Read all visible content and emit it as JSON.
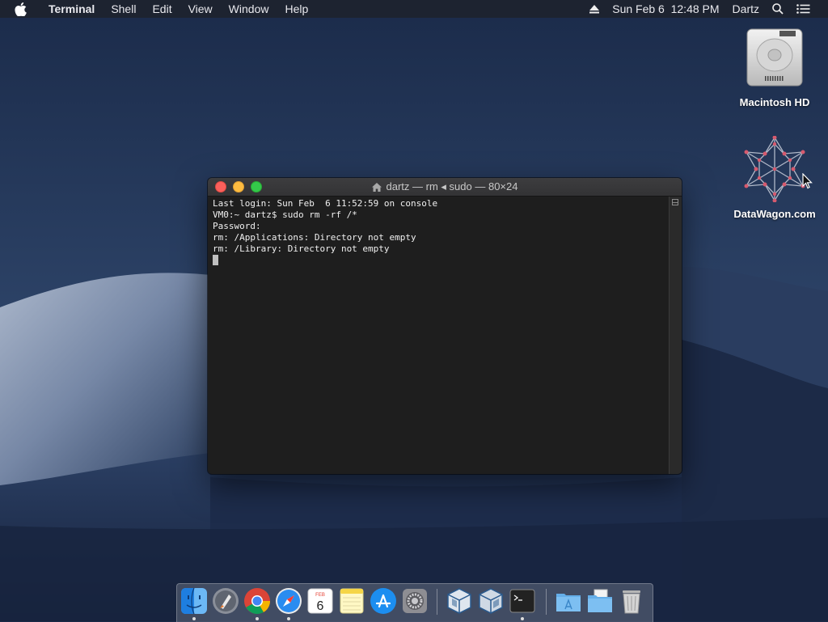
{
  "menubar": {
    "app_name": "Terminal",
    "menus": [
      "Shell",
      "Edit",
      "View",
      "Window",
      "Help"
    ],
    "clock": "Sun Feb 6  12:48 PM",
    "user": "Dartz"
  },
  "desktop": {
    "icons": [
      {
        "label": "Macintosh HD"
      },
      {
        "label": "DataWagon.com"
      }
    ]
  },
  "terminal": {
    "title": "dartz — rm ◂ sudo — 80×24",
    "lines": [
      "Last login: Sun Feb  6 11:52:59 on console",
      "VM0:~ dartz$ sudo rm -rf /*",
      "Password:",
      "rm: /Applications: Directory not empty",
      "rm: /Library: Directory not empty"
    ]
  },
  "dock": {
    "items": [
      {
        "name": "finder-icon",
        "running": true
      },
      {
        "name": "launchpad-icon",
        "running": false
      },
      {
        "name": "chrome-icon",
        "running": true
      },
      {
        "name": "safari-icon",
        "running": true
      },
      {
        "name": "calendar-icon",
        "running": false,
        "month": "FEB",
        "day": "6"
      },
      {
        "name": "notes-icon",
        "running": false
      },
      {
        "name": "app-store-icon",
        "running": false
      },
      {
        "name": "system-preferences-icon",
        "running": false
      },
      {
        "name": "virtualbox-icon",
        "running": false
      },
      {
        "name": "virtualbox-vm-icon",
        "running": false
      },
      {
        "name": "terminal-icon",
        "running": true
      },
      {
        "name": "applications-folder-icon",
        "running": false
      },
      {
        "name": "documents-folder-icon",
        "running": false
      },
      {
        "name": "trash-icon",
        "running": false
      }
    ]
  },
  "colors": {
    "close": "#fc605b",
    "minimize": "#fdbc40",
    "maximize": "#34c84a"
  }
}
